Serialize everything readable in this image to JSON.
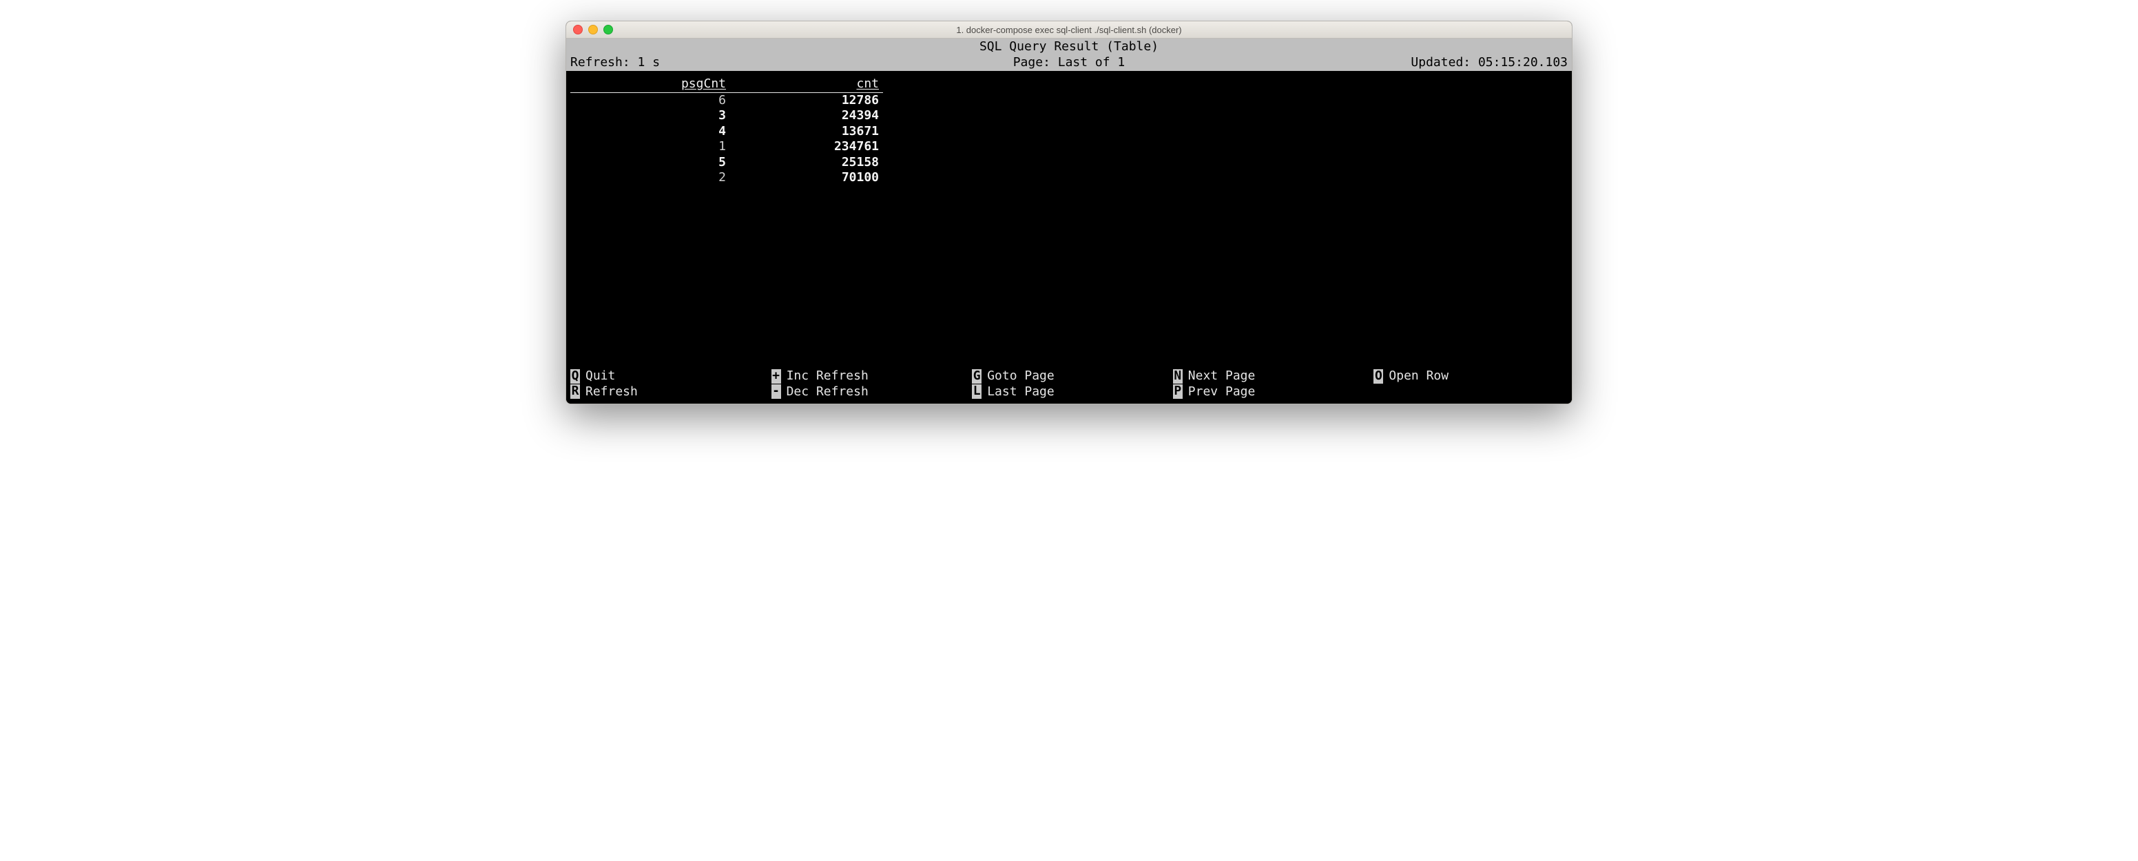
{
  "window": {
    "title": "1. docker-compose exec sql-client ./sql-client.sh (docker)"
  },
  "header": {
    "title": "SQL Query Result (Table)",
    "refresh": "Refresh: 1 s",
    "page": "Page: Last of 1",
    "updated": "Updated: 05:15:20.103"
  },
  "columns": {
    "psgCnt": "psgCnt",
    "cnt": "cnt"
  },
  "rows": [
    {
      "psgCnt": "6",
      "psgBold": false,
      "cnt": "12786",
      "cntBold": true
    },
    {
      "psgCnt": "3",
      "psgBold": true,
      "cnt": "24394",
      "cntBold": true
    },
    {
      "psgCnt": "4",
      "psgBold": true,
      "cnt": "13671",
      "cntBold": true
    },
    {
      "psgCnt": "1",
      "psgBold": false,
      "cnt": "234761",
      "cntBold": true
    },
    {
      "psgCnt": "5",
      "psgBold": true,
      "cnt": "25158",
      "cntBold": true
    },
    {
      "psgCnt": "2",
      "psgBold": false,
      "cnt": "70100",
      "cntBold": true
    }
  ],
  "commands": [
    [
      {
        "key": "Q",
        "label": "Quit"
      },
      {
        "key": "+",
        "label": "Inc Refresh"
      },
      {
        "key": "G",
        "label": "Goto Page"
      },
      {
        "key": "N",
        "label": "Next Page"
      },
      {
        "key": "O",
        "label": "Open Row"
      }
    ],
    [
      {
        "key": "R",
        "label": "Refresh"
      },
      {
        "key": "-",
        "label": "Dec Refresh"
      },
      {
        "key": "L",
        "label": "Last Page"
      },
      {
        "key": "P",
        "label": "Prev Page"
      },
      {
        "key": "",
        "label": ""
      }
    ]
  ]
}
